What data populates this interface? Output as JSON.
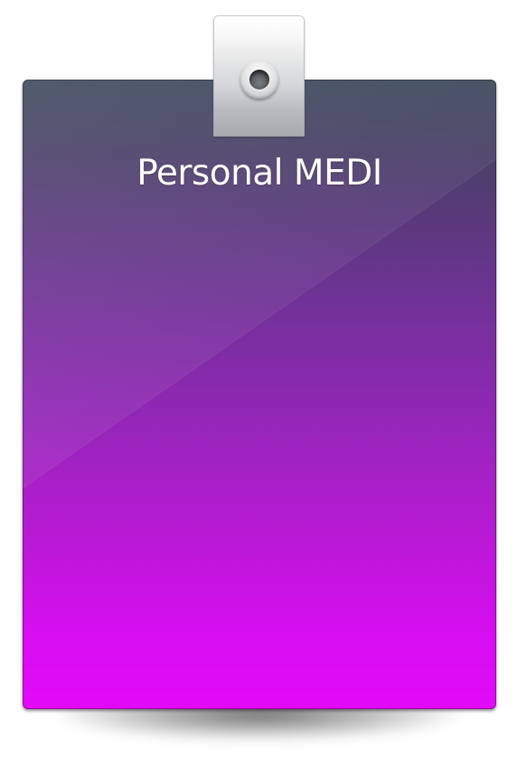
{
  "card": {
    "title": "Personal MEDI"
  },
  "colors": {
    "card_top": "#3d4a5c",
    "card_bottom": "#e20af9",
    "title_text": "#ffffff",
    "tab": "#d4d6d9"
  },
  "icons": {
    "tab_eyelet": "eyelet-icon"
  }
}
